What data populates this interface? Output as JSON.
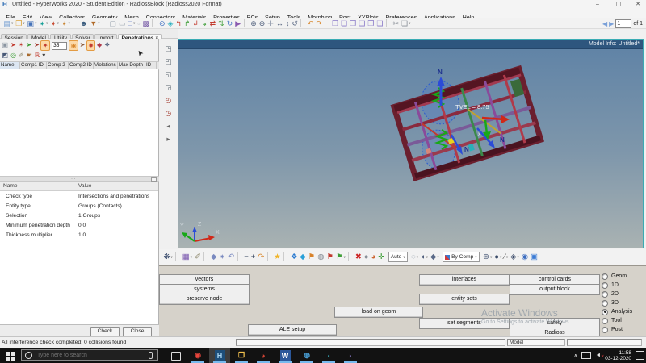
{
  "window": {
    "title": "Untitled - HyperWorks 2020 - Student Edition - RadiossBlock (Radioss2020 Format)",
    "logo": "H",
    "controls": {
      "minimize": "–",
      "maximize": "▢",
      "close": "✕"
    }
  },
  "menu": {
    "items": [
      "File",
      "Edit",
      "View",
      "Collectors",
      "Geometry",
      "Mesh",
      "Connectors",
      "Materials",
      "Properties",
      "BCs",
      "Setup",
      "Tools",
      "Morphing",
      "Post",
      "XYPlots",
      "Preferences",
      "Applications",
      "Help"
    ]
  },
  "toolbar": {
    "icons": [
      {
        "n": "new-file",
        "g": "▤",
        "c": "#6f9ad0",
        "d": 1
      },
      {
        "n": "open-file",
        "g": "❒",
        "c": "#d9a23c",
        "d": 1
      },
      {
        "n": "save-file",
        "g": "▣",
        "c": "#4472b8",
        "d": 1
      },
      {
        "n": "import-file",
        "g": "➧",
        "c": "#18a098",
        "d": 1
      },
      {
        "n": "export-file",
        "g": "➧",
        "c": "#c84b32",
        "d": 1
      },
      {
        "n": "load-file",
        "g": "➧",
        "c": "#c88432",
        "d": 1
      },
      {
        "sep": 1
      },
      {
        "n": "user-profile",
        "g": "☻",
        "c": "#3b5d7e"
      },
      {
        "n": "organize",
        "g": "▼",
        "c": "#b06a28",
        "d": 1
      },
      {
        "sep": 1
      },
      {
        "n": "select-entities",
        "g": "▢",
        "c": "#9aa4ae"
      },
      {
        "n": "select-window",
        "g": "▭",
        "c": "#9aa4ae"
      },
      {
        "n": "clear-mark",
        "g": "□",
        "c": "#6f86c8",
        "d": 1
      },
      {
        "n": "reject-selection",
        "g": "▫",
        "c": "#b8c0c8"
      },
      {
        "n": "entity-editor",
        "g": "▩",
        "c": "#7d62aa"
      },
      {
        "sep": 1
      },
      {
        "n": "zoom-select",
        "g": "⊙",
        "c": "#3a6cc0"
      },
      {
        "n": "fit-view",
        "g": "◈",
        "c": "#2ab0c0"
      },
      {
        "n": "view-left",
        "g": "↰",
        "c": "#c23a2e"
      },
      {
        "n": "view-right",
        "g": "↱",
        "c": "#3f9e38"
      },
      {
        "n": "view-top",
        "g": "↲",
        "c": "#c23a2e"
      },
      {
        "n": "view-bottom",
        "g": "↳",
        "c": "#3f9e38"
      },
      {
        "n": "view-front",
        "g": "⇄",
        "c": "#c23a2e"
      },
      {
        "n": "view-rear",
        "g": "⇅",
        "c": "#3f9e38"
      },
      {
        "n": "view-iso",
        "g": "↻",
        "c": "#3a6cc0"
      },
      {
        "n": "saved-views",
        "g": "▶",
        "c": "#8a5ab0"
      },
      {
        "sep": 1
      },
      {
        "n": "zoom-in",
        "g": "⊕",
        "c": "#4a5a78"
      },
      {
        "n": "zoom-out",
        "g": "⊖",
        "c": "#4a5a78"
      },
      {
        "n": "pan",
        "g": "✛",
        "c": "#4a5a78"
      },
      {
        "n": "arrows-horizontal",
        "g": "↔",
        "c": "#4a5a78"
      },
      {
        "n": "arrows-vertical",
        "g": "↕",
        "c": "#4a5a78"
      },
      {
        "n": "rotate-view",
        "g": "↺",
        "c": "#4a5a78"
      },
      {
        "sep": 1
      },
      {
        "n": "undo",
        "g": "↶",
        "c": "#d8882e"
      },
      {
        "n": "redo",
        "g": "↷",
        "c": "#d8882e"
      },
      {
        "sep": 1
      },
      {
        "n": "window-layout-1",
        "g": "❒",
        "c": "#8a7ac8"
      },
      {
        "n": "window-layout-2",
        "g": "❏",
        "c": "#8a7ac8"
      },
      {
        "n": "window-layout-3",
        "g": "❒",
        "c": "#8a7ac8"
      },
      {
        "n": "window-layout-4",
        "g": "❏",
        "c": "#8a7ac8"
      },
      {
        "n": "window-layout-5",
        "g": "❒",
        "c": "#8a7ac8"
      },
      {
        "n": "window-layout-6",
        "g": "❏",
        "c": "#8a7ac8"
      },
      {
        "sep": 1
      },
      {
        "n": "cut",
        "g": "✂",
        "c": "#8a9098"
      },
      {
        "n": "copy",
        "g": "❏",
        "c": "#8a9098",
        "d": 1
      }
    ],
    "pager": {
      "prev": "◀",
      "next": "▶",
      "value": "1",
      "of": "of 1"
    }
  },
  "left_panel": {
    "tabs": [
      "Session",
      "Model",
      "Utility",
      "Solver",
      "Import",
      "Penetrations"
    ],
    "active_tab": "Penetrations",
    "tab_close": "×",
    "toolbar_row1": [
      {
        "n": "entity-selector",
        "g": "▣",
        "c": "#8a94a0"
      },
      {
        "n": "check-penetration",
        "g": "➤",
        "c": "#c23a2e"
      },
      {
        "n": "check-intersection",
        "g": "✶",
        "c": "#c23a2e"
      },
      {
        "n": "check-both",
        "g": "➤",
        "c": "#3f9e38"
      },
      {
        "n": "recheck",
        "g": "➤",
        "c": "#a23a2e"
      },
      {
        "n": "highlight-failed",
        "g": "✦",
        "c": "#c23a2e",
        "hl": 1
      }
    ],
    "tolerance_value": "35",
    "toolbar_row1b": [
      {
        "n": "isolate",
        "g": "◉",
        "c": "#d8882e",
        "hl": 1
      },
      {
        "n": "show-adjacent",
        "g": "➤",
        "c": "#8a5a3a"
      },
      {
        "n": "fix-penetration",
        "g": "✹",
        "c": "#c23a2e",
        "hl": 1
      },
      {
        "n": "depth-display",
        "g": "◆",
        "c": "#b03a4a"
      },
      {
        "n": "settings",
        "g": "❖",
        "c": "#4a5a78"
      }
    ],
    "toolbar_row2": [
      {
        "n": "pointer-mode",
        "g": "◩",
        "c": "#4a5a78"
      },
      {
        "n": "refresh-results",
        "g": "◎",
        "c": "#3f9e38"
      },
      {
        "n": "edit-tool",
        "g": "✐",
        "c": "#8a8468"
      },
      {
        "n": "pan-hand",
        "g": "☛",
        "c": "#a86a2e"
      },
      {
        "n": "reset-check",
        "g": "ℝ",
        "c": "#c23a2e"
      },
      {
        "n": "more-options",
        "g": "▾",
        "c": "#444444"
      }
    ],
    "results_table": {
      "columns": [
        "Name",
        "Comp1 ID",
        "Comp 2",
        "Comp2 ID",
        "Violations",
        "Max Depth",
        "ID"
      ]
    },
    "splitter_dots": "· · ·",
    "properties_table": {
      "header": {
        "name": "Name",
        "value": "Value"
      },
      "rows": [
        [
          "Check type",
          "Intersections and penetrations"
        ],
        [
          "Entity type",
          "Groups (Contacts)"
        ],
        [
          "Selection",
          "1 Groups"
        ],
        [
          "Minimum penetration depth",
          "0.0"
        ],
        [
          "Thickness multiplier",
          "1.0"
        ]
      ]
    },
    "check_button": "Check",
    "close_button": "Close"
  },
  "vstrip": {
    "icons": [
      {
        "n": "iso-view",
        "g": "◳",
        "c": "#55606a"
      },
      {
        "n": "top-view",
        "g": "◰",
        "c": "#55606a"
      },
      {
        "n": "front-view",
        "g": "◱",
        "c": "#55606a"
      },
      {
        "n": "side-view",
        "g": "◲",
        "c": "#55606a"
      },
      {
        "n": "rotate-ccw",
        "g": "◴",
        "c": "#a23a2e"
      },
      {
        "n": "rotate-cw",
        "g": "◷",
        "c": "#a23a2e"
      },
      {
        "n": "previous-view",
        "g": "◂",
        "c": "#666666"
      },
      {
        "n": "next-view",
        "g": "▸",
        "c": "#666666"
      }
    ]
  },
  "viewport": {
    "model_info": "Model Info: Untitled*",
    "annotation": "TVEL = 8.75",
    "north_label": "N",
    "x_small_label": "x",
    "axis": {
      "x": "X",
      "y": "Y",
      "z": "Z"
    }
  },
  "bottom_toolbar": {
    "icons_a": [
      {
        "n": "mask",
        "g": "❋",
        "c": "#4a5a78",
        "d": 1
      },
      {
        "sep": 1
      },
      {
        "n": "model-browser",
        "g": "▦",
        "c": "#7d5bb0",
        "d": 1
      },
      {
        "n": "attach",
        "g": "✐",
        "c": "#8a8468"
      },
      {
        "sep": 1
      },
      {
        "n": "previous-panel",
        "g": "◆",
        "c": "#7a8ac0"
      },
      {
        "n": "next-panel",
        "g": "➧",
        "c": "#7a8ac0"
      },
      {
        "n": "revert",
        "g": "↶",
        "c": "#7a8ac0"
      },
      {
        "sep": 1
      },
      {
        "n": "decrease",
        "g": "−",
        "c": "#30405a"
      },
      {
        "n": "increase",
        "g": "+",
        "c": "#30405a"
      },
      {
        "n": "redo-step",
        "g": "↷",
        "c": "#d8882e"
      },
      {
        "sep": 1
      },
      {
        "n": "favorites",
        "g": "★",
        "c": "#f0b429"
      },
      {
        "sep": 1
      },
      {
        "n": "show-components",
        "g": "❖",
        "c": "#2a7ad0"
      },
      {
        "n": "show-elements",
        "g": "◆",
        "c": "#2aa0d8"
      },
      {
        "n": "show-loads",
        "g": "⚑",
        "c": "#d8822a"
      },
      {
        "n": "show-spheres",
        "g": "◍",
        "c": "#8a9098"
      },
      {
        "n": "flag-red",
        "g": "⚑",
        "c": "#c23a2e"
      },
      {
        "n": "flag-green",
        "g": "⚑",
        "c": "#3f9e38",
        "d": 1
      },
      {
        "sep": 1
      },
      {
        "n": "delete",
        "g": "✖",
        "c": "#cc2222"
      },
      {
        "n": "sphere-gray",
        "g": "●",
        "c": "#8a9098"
      },
      {
        "n": "sphere-orange",
        "g": "◕",
        "c": "#cc6633"
      },
      {
        "n": "global-axes",
        "g": "✛",
        "c": "#3f9e38"
      }
    ],
    "auto_select": "Auto",
    "icons_b": [
      {
        "n": "wireframe-mode",
        "g": "◌",
        "c": "#7a8a9a",
        "d": 1
      },
      {
        "n": "shaded-mode",
        "g": "◖",
        "c": "#4a5a78",
        "d": 1
      },
      {
        "n": "solid-mode",
        "g": "◆",
        "c": "#5a6a88",
        "d": 1
      }
    ],
    "by_comp": "By Comp",
    "icons_c": [
      {
        "n": "wireframe-sphere",
        "g": "⊛",
        "c": "#4a5a78",
        "d": 1
      },
      {
        "n": "shaded-sphere",
        "g": "●",
        "c": "#3a4a68",
        "d": 1
      },
      {
        "n": "element-edges",
        "g": "∕",
        "c": "#555555",
        "d": 1
      },
      {
        "n": "feature-lines",
        "g": "◈",
        "c": "#3a4a68",
        "d": 1
      },
      {
        "n": "mesh-lines",
        "g": "◉",
        "c": "#3a6cc0"
      },
      {
        "n": "performance-monitor",
        "g": "▣",
        "c": "#3a7bd5"
      }
    ]
  },
  "panel": {
    "buttons": {
      "vectors": "vectors",
      "systems": "systems",
      "preserve_node": "preserve node",
      "load_on_geom": "load on geom",
      "ale_setup": "ALE setup",
      "interfaces": "interfaces",
      "entity_sets": "entity sets",
      "set_segments": "set segments",
      "control_cards": "control cards",
      "output_block": "output block",
      "safety": "safety",
      "radioss": "Radioss"
    },
    "radios": {
      "options": [
        "Geom",
        "1D",
        "2D",
        "3D",
        "Analysis",
        "Tool",
        "Post"
      ],
      "selected": "Analysis"
    }
  },
  "watermark": {
    "line1": "Activate Windows",
    "line2": "Go to Settings to activate Windows"
  },
  "status_bar": {
    "message": "All interference check completed: 0 collisions found",
    "model_label": "Model"
  },
  "taskbar": {
    "search_placeholder": "Type here to search",
    "apps": [
      {
        "n": "chrome",
        "g": "◉",
        "c": "#e8453c"
      },
      {
        "n": "hyperworks",
        "g": "H",
        "c": "#a8d4f0",
        "tile": "#1d4e79",
        "active": 1
      },
      {
        "n": "file-explorer",
        "g": "❒",
        "c": "#f2c14e"
      },
      {
        "n": "app-red-white",
        "g": "◕",
        "c": "#d04434"
      },
      {
        "n": "word",
        "g": "W",
        "c": "#ffffff",
        "tile": "#2b579a"
      },
      {
        "n": "app-blue-sphere",
        "g": "◍",
        "c": "#4aa3dc"
      },
      {
        "n": "app-teal",
        "g": "◖",
        "c": "#3ab0c0"
      },
      {
        "n": "app-swirl",
        "g": "◗",
        "c": "#8a7ac8"
      }
    ],
    "tray": {
      "caret": "∧",
      "time": "11:58",
      "date": "03-12-2020"
    }
  }
}
